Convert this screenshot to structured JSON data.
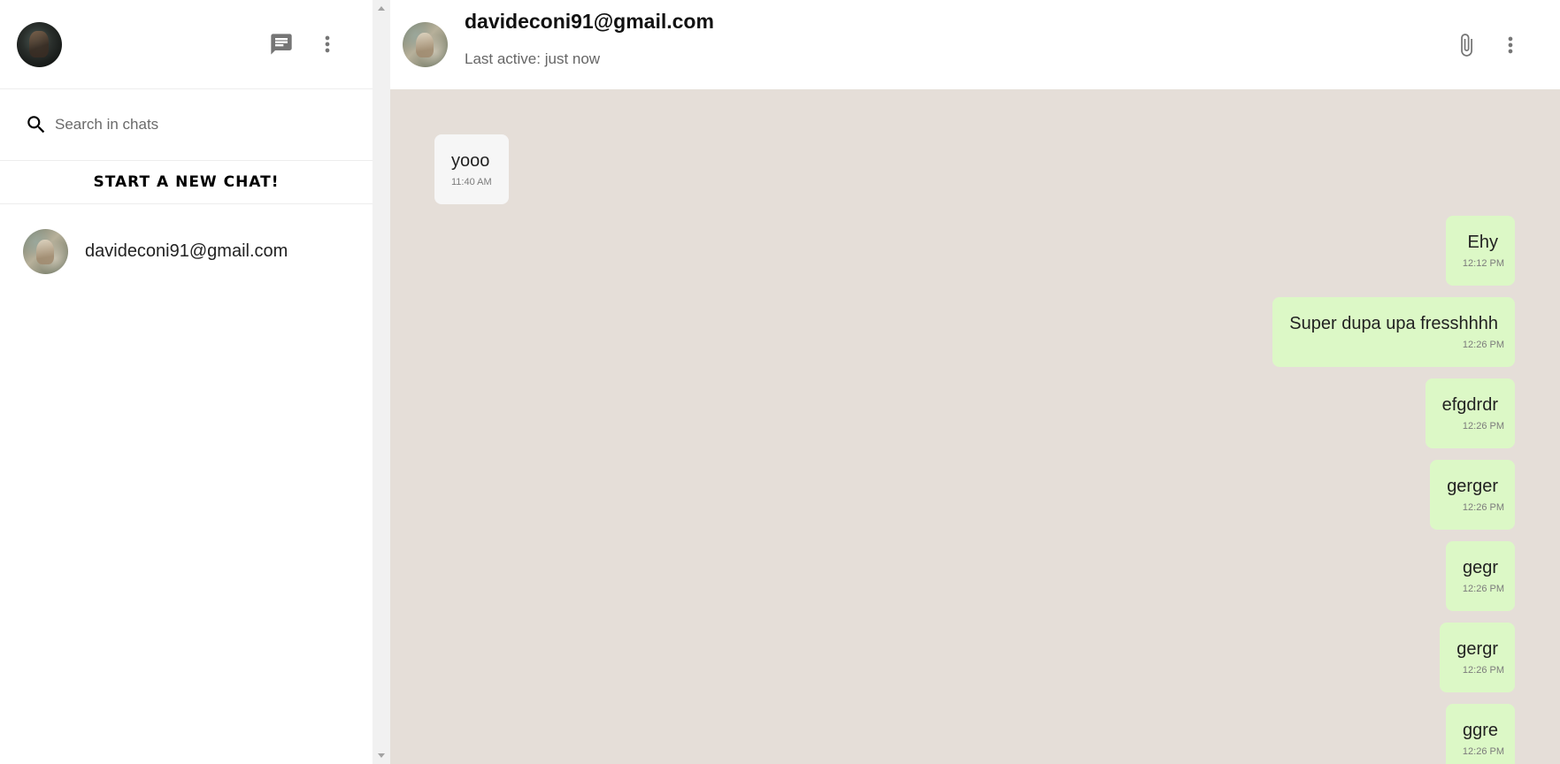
{
  "sidebar": {
    "search": {
      "placeholder": "Search in chats"
    },
    "new_chat_label": "START A NEW CHAT!",
    "chats": [
      {
        "name": "davideconi91@gmail.com"
      }
    ]
  },
  "chat": {
    "header": {
      "title": "davideconi91@gmail.com",
      "subtitle": "Last active: just now"
    },
    "messages": [
      {
        "direction": "incoming",
        "text": "yooo",
        "time": "11:40 AM"
      },
      {
        "direction": "outgoing",
        "text": "Ehy",
        "time": "12:12 PM"
      },
      {
        "direction": "outgoing",
        "text": "Super dupa upa fresshhhh",
        "time": "12:26 PM"
      },
      {
        "direction": "outgoing",
        "text": "efgdrdr",
        "time": "12:26 PM"
      },
      {
        "direction": "outgoing",
        "text": "gerger",
        "time": "12:26 PM"
      },
      {
        "direction": "outgoing",
        "text": "gegr",
        "time": "12:26 PM"
      },
      {
        "direction": "outgoing",
        "text": "gergr",
        "time": "12:26 PM"
      },
      {
        "direction": "outgoing",
        "text": "ggre",
        "time": "12:26 PM"
      }
    ]
  },
  "colors": {
    "chat_background": "#e5ded8",
    "outgoing_bubble": "#dcf8c6",
    "incoming_bubble": "#f6f6f6",
    "icon_gray": "#757575"
  },
  "icons": {
    "new_chat": "chat-icon",
    "sidebar_menu": "more-vert-icon",
    "search": "search-icon",
    "attach": "paperclip-icon",
    "chat_menu": "more-vert-icon"
  }
}
